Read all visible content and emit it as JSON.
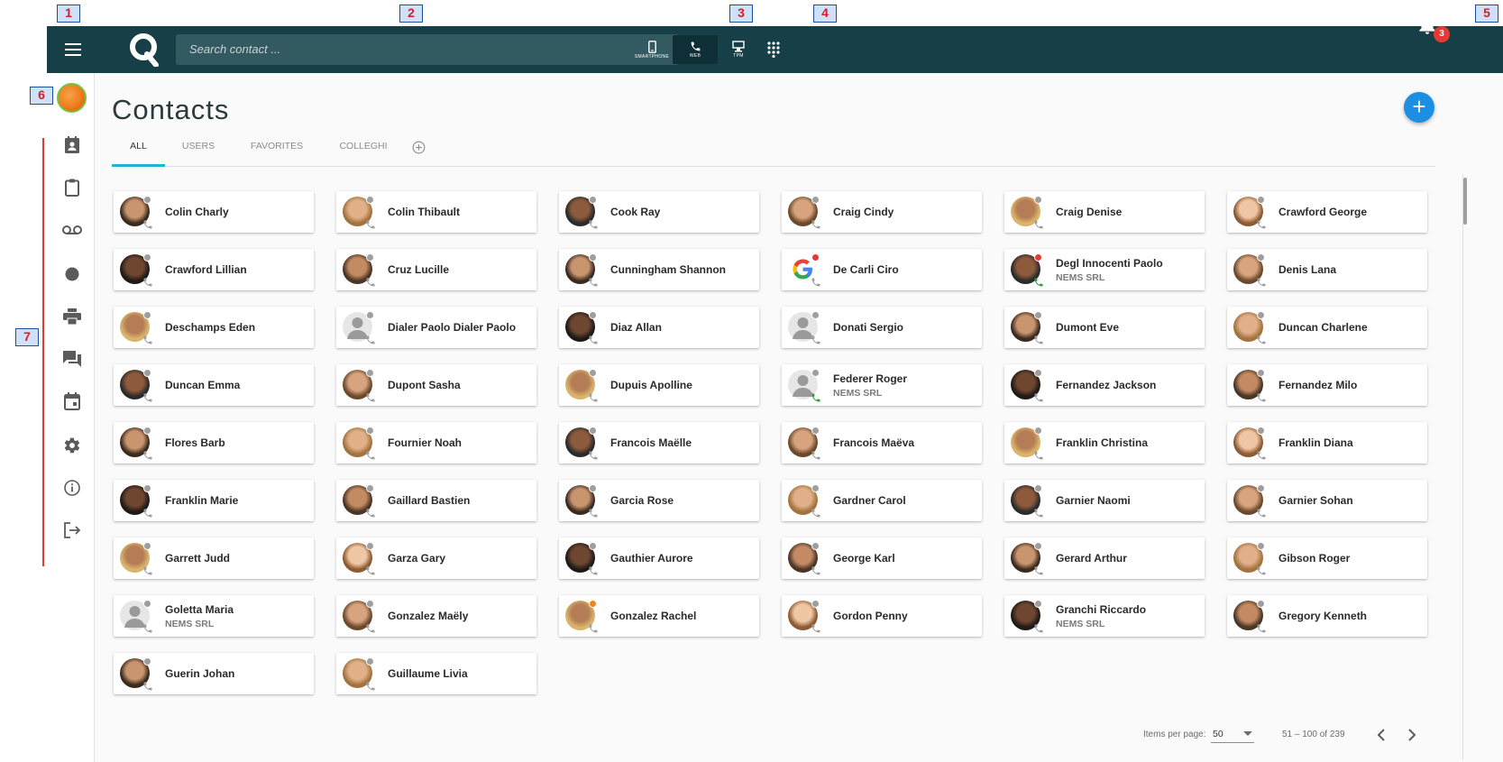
{
  "annotations": [
    "1",
    "2",
    "3",
    "4",
    "5",
    "6",
    "7"
  ],
  "topbar": {
    "search_placeholder": "Search contact ...",
    "devices": [
      {
        "label": "SMARTPHONE",
        "icon": "smartphone-icon"
      },
      {
        "label": "WEB",
        "icon": "phone-icon",
        "active": true
      },
      {
        "label": "TPM",
        "icon": "desk-phone-icon"
      }
    ],
    "notification_count": "3"
  },
  "sidebar": {
    "items": [
      "contacts-icon",
      "clipboard-icon",
      "voicemail-icon",
      "record-icon",
      "print-icon",
      "chat-icon",
      "calendar-icon",
      "settings-icon",
      "info-icon",
      "logout-icon"
    ]
  },
  "page": {
    "title": "Contacts",
    "tabs": [
      {
        "label": "ALL",
        "active": true
      },
      {
        "label": "USERS"
      },
      {
        "label": "FAVORITES"
      },
      {
        "label": "COLLEGHI"
      }
    ]
  },
  "contacts": [
    {
      "name": "Colin Charly"
    },
    {
      "name": "Colin Thibault"
    },
    {
      "name": "Cook Ray"
    },
    {
      "name": "Craig Cindy"
    },
    {
      "name": "Craig Denise"
    },
    {
      "name": "Crawford George"
    },
    {
      "name": "Crawford Lillian"
    },
    {
      "name": "Cruz Lucille"
    },
    {
      "name": "Cunningham Shannon"
    },
    {
      "name": "De Carli Ciro",
      "avatar": "google",
      "presence": "red"
    },
    {
      "name": "Degl Innocenti Paolo",
      "company": "NEMS SRL",
      "presence": "red",
      "phone": "green"
    },
    {
      "name": "Denis Lana"
    },
    {
      "name": "Deschamps Eden"
    },
    {
      "name": "Dialer Paolo Dialer Paolo",
      "avatar": "silhouette"
    },
    {
      "name": "Diaz Allan"
    },
    {
      "name": "Donati Sergio",
      "avatar": "silhouette"
    },
    {
      "name": "Dumont Eve"
    },
    {
      "name": "Duncan Charlene"
    },
    {
      "name": "Duncan Emma"
    },
    {
      "name": "Dupont Sasha"
    },
    {
      "name": "Dupuis Apolline"
    },
    {
      "name": "Federer Roger",
      "company": "NEMS SRL",
      "avatar": "silhouette",
      "phone": "green"
    },
    {
      "name": "Fernandez Jackson"
    },
    {
      "name": "Fernandez Milo"
    },
    {
      "name": "Flores Barb"
    },
    {
      "name": "Fournier Noah"
    },
    {
      "name": "Francois Maëlle"
    },
    {
      "name": "Francois Maëva"
    },
    {
      "name": "Franklin Christina"
    },
    {
      "name": "Franklin Diana"
    },
    {
      "name": "Franklin Marie"
    },
    {
      "name": "Gaillard Bastien"
    },
    {
      "name": "Garcia Rose"
    },
    {
      "name": "Gardner Carol"
    },
    {
      "name": "Garnier Naomi"
    },
    {
      "name": "Garnier Sohan"
    },
    {
      "name": "Garrett Judd"
    },
    {
      "name": "Garza Gary"
    },
    {
      "name": "Gauthier Aurore"
    },
    {
      "name": "George Karl"
    },
    {
      "name": "Gerard Arthur"
    },
    {
      "name": "Gibson Roger"
    },
    {
      "name": "Goletta Maria",
      "company": "NEMS SRL",
      "avatar": "silhouette"
    },
    {
      "name": "Gonzalez Maëly"
    },
    {
      "name": "Gonzalez Rachel",
      "presence": "orange"
    },
    {
      "name": "Gordon Penny"
    },
    {
      "name": "Granchi Riccardo",
      "company": "NEMS SRL"
    },
    {
      "name": "Gregory Kenneth"
    },
    {
      "name": "Guerin Johan"
    },
    {
      "name": "Guillaume Livia"
    }
  ],
  "pagination": {
    "items_per_page_label": "Items per page:",
    "items_per_page_value": "50",
    "range": "51 – 100 of 239"
  },
  "colors": {
    "topbar": "#173f47",
    "accent": "#1fb3d6",
    "fab": "#1b8fe4",
    "badge": "#e53935",
    "presence_offline": "#9e9e9e",
    "presence_busy": "#e53935",
    "presence_away": "#f58220",
    "phone_active": "#2e9e3a"
  }
}
